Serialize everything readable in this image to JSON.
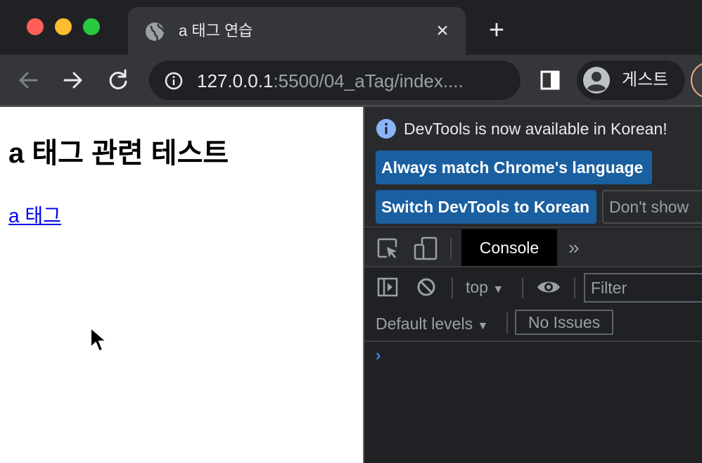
{
  "browser": {
    "tab": {
      "title": "a 태그 연습",
      "close_glyph": "×",
      "icon": "globe-icon"
    },
    "new_tab_glyph": "+",
    "toolbar": {
      "back_icon": "arrow-left-icon",
      "forward_icon": "arrow-right-icon",
      "reload_icon": "reload-icon",
      "address": {
        "host": "127.0.0.1",
        "path": ":5500/04_aTag/index....",
        "security_icon": "info-icon"
      },
      "side_panel_icon": "side-panel-icon",
      "profile_label": "게스트"
    },
    "colors": {
      "frame": "#202124",
      "toolbar": "#35363a",
      "text": "#e8eaed"
    }
  },
  "page": {
    "heading": "a 태그 관련 테스트",
    "link_text": "a 태그",
    "link_color": "#0000ee"
  },
  "devtools": {
    "infobar": {
      "message": "DevTools is now available in Korean!",
      "always_match_button": "Always match Chrome's language",
      "switch_button": "Switch DevTools to Korean",
      "dont_show_button": "Don't show",
      "accent": "#1a5fa0"
    },
    "tabs": {
      "active": "Console",
      "more_glyph": "»"
    },
    "console_toolbar": {
      "context": "top",
      "context_arrow": "▼",
      "filter_placeholder": "Filter",
      "levels": "Default levels",
      "levels_arrow": "▼",
      "issues": "No Issues"
    },
    "prompt_glyph": "›"
  }
}
